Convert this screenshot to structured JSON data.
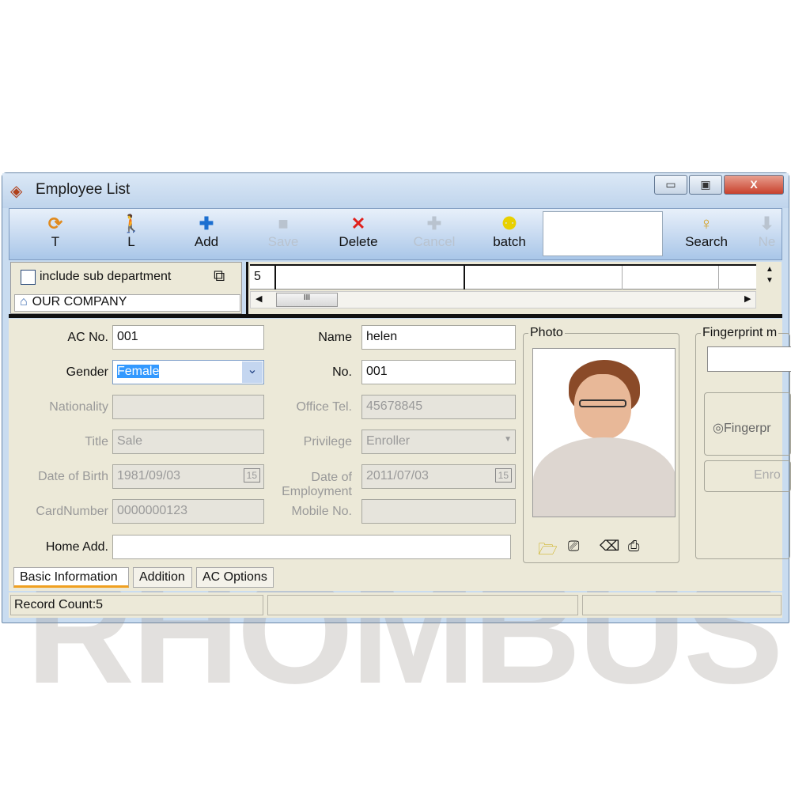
{
  "window": {
    "title": "Employee List",
    "minimize": "▭",
    "maximize": "▣",
    "close": "X"
  },
  "toolbar": {
    "buttons": [
      {
        "label": "T",
        "icon": "refresh-icon",
        "enabled": true,
        "color": "#e08a1e"
      },
      {
        "label": "L",
        "icon": "exit-icon",
        "enabled": true,
        "color": "#c0202a"
      },
      {
        "label": "Add",
        "icon": "plus-icon",
        "enabled": true,
        "color": "#1c6fd0"
      },
      {
        "label": "Save",
        "icon": "save-icon",
        "enabled": false,
        "color": "#b9c3cf"
      },
      {
        "label": "Delete",
        "icon": "x-icon",
        "enabled": true,
        "color": "#e0201c"
      },
      {
        "label": "Cancel",
        "icon": "plus-icon",
        "enabled": false,
        "color": "#b9c3cf"
      },
      {
        "label": "batch",
        "icon": "people-icon",
        "enabled": true,
        "color": "#e8d000"
      },
      {
        "label": "Search",
        "icon": "search-icon",
        "enabled": true,
        "color": "#d6a020"
      },
      {
        "label": "Ne",
        "icon": "down-arrow-icon",
        "enabled": false,
        "color": "#b9c3cf"
      }
    ],
    "search_value": ""
  },
  "left_panel": {
    "include_sub_department": "include sub department",
    "checked": false,
    "company": "OUR COMPANY"
  },
  "grid": {
    "record_cell": "5"
  },
  "form": {
    "ac_no": {
      "label": "AC No.",
      "value": "001"
    },
    "gender": {
      "label": "Gender",
      "value": "Female"
    },
    "nationality": {
      "label": "Nationality",
      "value": ""
    },
    "title": {
      "label": "Title",
      "value": "Sale"
    },
    "dob": {
      "label": "Date of Birth",
      "value": "1981/09/03"
    },
    "card": {
      "label": "CardNumber",
      "value": "0000000123"
    },
    "home": {
      "label": "Home Add.",
      "value": ""
    },
    "name": {
      "label": "Name",
      "value": "helen"
    },
    "no": {
      "label": "No.",
      "value": "001"
    },
    "office_tel": {
      "label": "Office Tel.",
      "value": "45678845"
    },
    "privilege": {
      "label": "Privilege",
      "value": "Enroller"
    },
    "doe": {
      "label1": "Date of",
      "label2": "Employment",
      "value": "2011/07/03"
    },
    "mobile": {
      "label": "Mobile No.",
      "value": ""
    },
    "calendar": "15"
  },
  "photo": {
    "label": "Photo"
  },
  "fingerprint": {
    "label": "Fingerprint m",
    "radio": "Fingerpr",
    "enroll": "Enro"
  },
  "watermark": "RHOMBUS",
  "tabs": [
    {
      "label": "Basic Information",
      "active": true
    },
    {
      "label": "Addition"
    },
    {
      "label": "AC Options"
    }
  ],
  "status": {
    "record_count": "Record Count:5"
  },
  "colors": {
    "accent": "#3a78d8",
    "selection": "#3399ff",
    "tab_underline": "#f0a020"
  }
}
